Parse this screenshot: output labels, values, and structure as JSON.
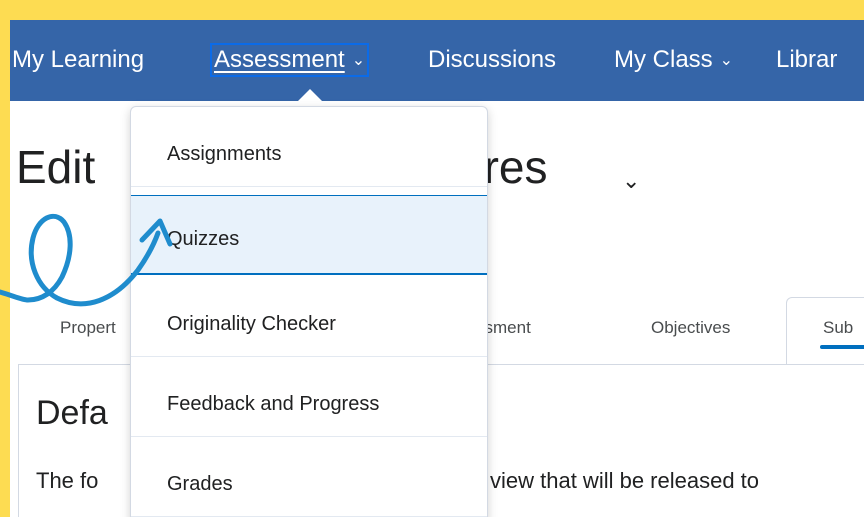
{
  "navbar": {
    "items": [
      {
        "label": "My Learning"
      },
      {
        "label": "Assessment",
        "chevron": "⌄"
      },
      {
        "label": "Discussions"
      },
      {
        "label": "My Class",
        "chevron": "⌄"
      },
      {
        "label": "Librar"
      }
    ]
  },
  "page": {
    "title_visible_left": "Edit",
    "title_visible_right": "ures",
    "title_chevron": "⌄"
  },
  "tabs": {
    "properties": "Propert",
    "assessment": "ssment",
    "objectives": "Objectives",
    "submission": "Sub"
  },
  "content": {
    "heading": "Defa",
    "text_left": "The fo",
    "text_right": "view that will be released to"
  },
  "dropdown": {
    "items": [
      {
        "label": "Assignments"
      },
      {
        "label": "Quizzes",
        "active": true
      },
      {
        "label": "Originality Checker"
      },
      {
        "label": "Feedback and Progress"
      },
      {
        "label": "Grades"
      }
    ]
  },
  "colors": {
    "background_frame": "#fddc52",
    "navbar": "#3565a8",
    "focus_outline": "#0b6be8",
    "active_item_bg": "#e8f2fb",
    "active_item_border": "#006fbf",
    "annotation_arrow": "#1f8ccd"
  },
  "icons": {
    "chevron": "chevron-down-icon",
    "annotation": "curly-arrow-icon"
  }
}
